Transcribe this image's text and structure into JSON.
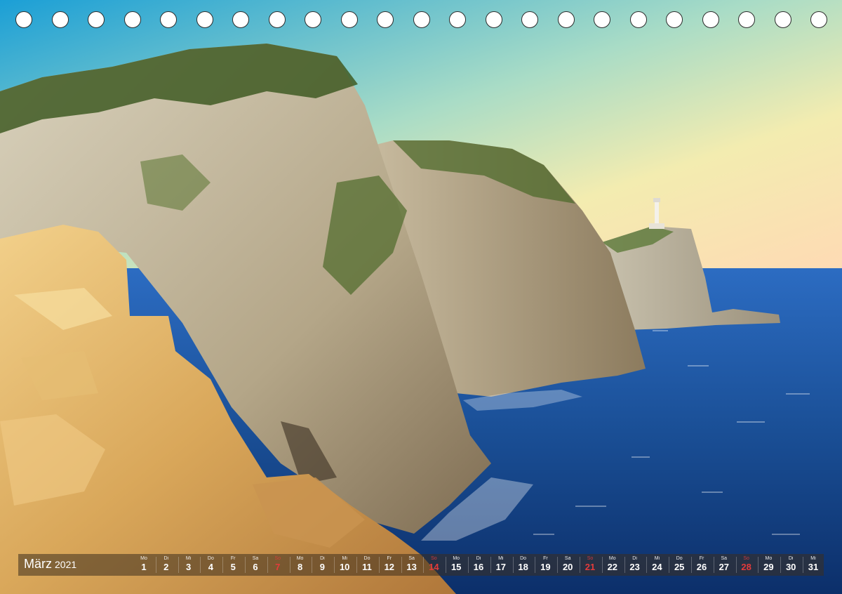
{
  "calendar": {
    "month": "März",
    "year": "2021",
    "days": [
      {
        "wd": "Mo",
        "d": "1"
      },
      {
        "wd": "Di",
        "d": "2"
      },
      {
        "wd": "Mi",
        "d": "3"
      },
      {
        "wd": "Do",
        "d": "4"
      },
      {
        "wd": "Fr",
        "d": "5"
      },
      {
        "wd": "Sa",
        "d": "6"
      },
      {
        "wd": "So",
        "d": "7"
      },
      {
        "wd": "Mo",
        "d": "8"
      },
      {
        "wd": "Di",
        "d": "9"
      },
      {
        "wd": "Mi",
        "d": "10"
      },
      {
        "wd": "Do",
        "d": "11"
      },
      {
        "wd": "Fr",
        "d": "12"
      },
      {
        "wd": "Sa",
        "d": "13"
      },
      {
        "wd": "So",
        "d": "14"
      },
      {
        "wd": "Mo",
        "d": "15"
      },
      {
        "wd": "Di",
        "d": "16"
      },
      {
        "wd": "Mi",
        "d": "17"
      },
      {
        "wd": "Do",
        "d": "18"
      },
      {
        "wd": "Fr",
        "d": "19"
      },
      {
        "wd": "Sa",
        "d": "20"
      },
      {
        "wd": "So",
        "d": "21"
      },
      {
        "wd": "Mo",
        "d": "22"
      },
      {
        "wd": "Di",
        "d": "23"
      },
      {
        "wd": "Mi",
        "d": "24"
      },
      {
        "wd": "Do",
        "d": "25"
      },
      {
        "wd": "Fr",
        "d": "26"
      },
      {
        "wd": "Sa",
        "d": "27"
      },
      {
        "wd": "So",
        "d": "28"
      },
      {
        "wd": "Mo",
        "d": "29"
      },
      {
        "wd": "Di",
        "d": "30"
      },
      {
        "wd": "Mi",
        "d": "31"
      }
    ]
  },
  "colors": {
    "sunday": "#e23b3b",
    "sea": "#1a4f96",
    "sky_top": "#2aa4d8",
    "sky_bottom": "#fde2b8"
  }
}
